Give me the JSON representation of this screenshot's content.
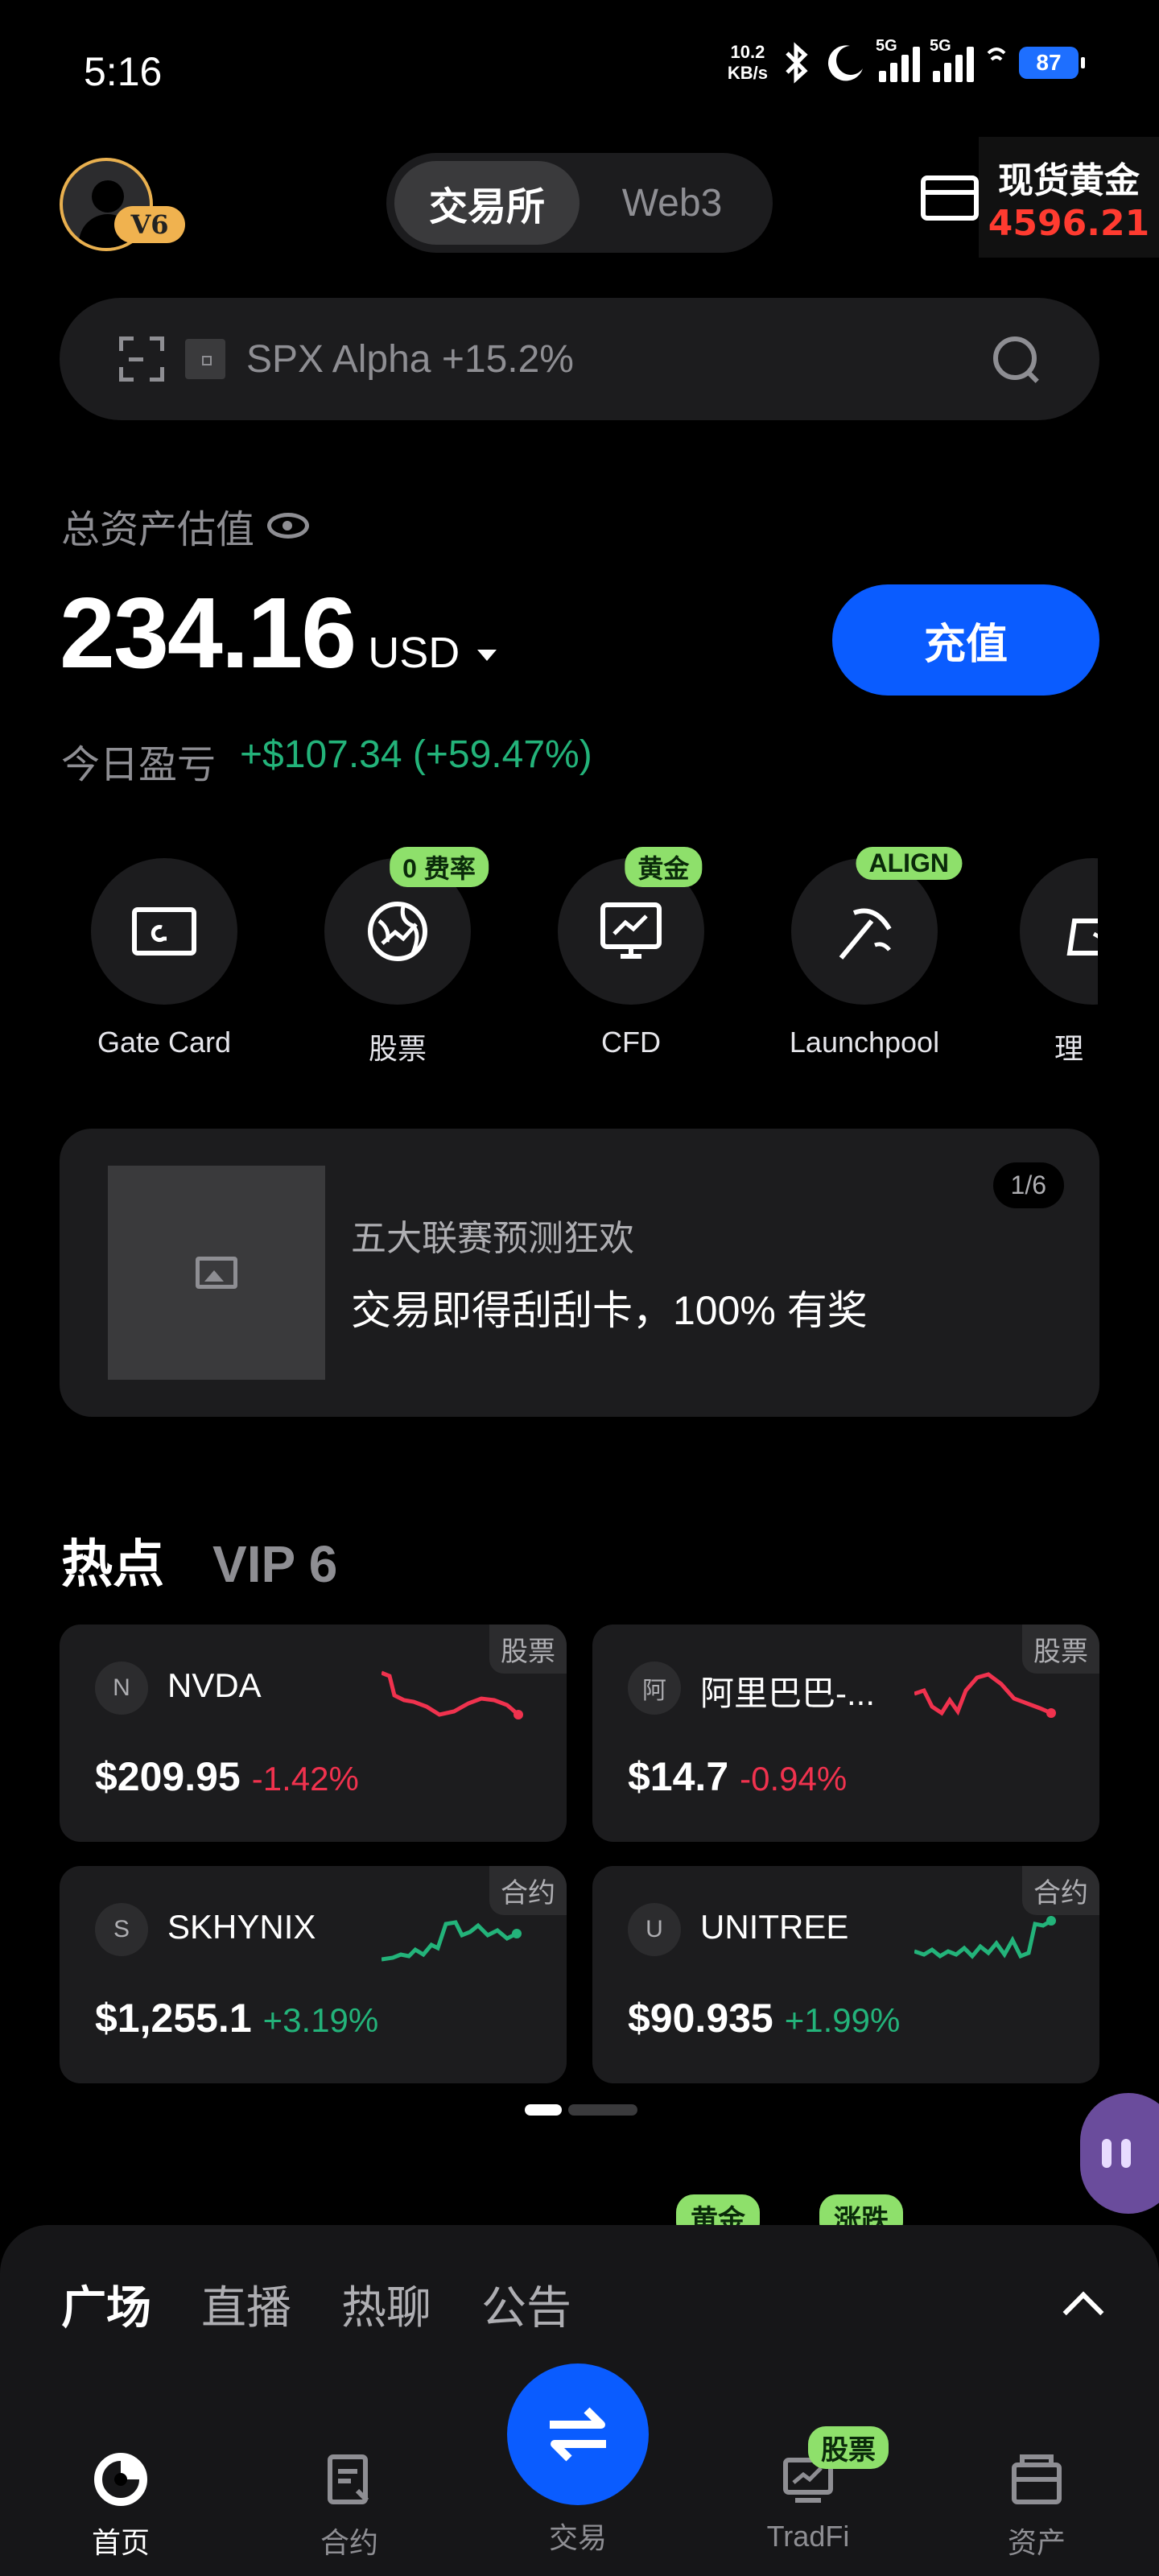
{
  "status_bar": {
    "time": "5:16",
    "net_speed_value": "10.2",
    "net_speed_unit": "KB/s",
    "signal1_label": "5G",
    "signal2_label": "5G",
    "battery": "87"
  },
  "header": {
    "vip_badge": "V6",
    "tabs": [
      {
        "label": "交易所",
        "active": true
      },
      {
        "label": "Web3",
        "active": false
      }
    ],
    "gold_widget_title": "现货黄金",
    "gold_widget_value": "4596.21"
  },
  "search": {
    "placeholder": "SPX Alpha +15.2%"
  },
  "assets": {
    "label": "总资产估值",
    "value": "234.16",
    "currency": "USD",
    "deposit_label": "充值",
    "pnl_label": "今日盈亏",
    "pnl_value": "+$107.34 (+59.47%)"
  },
  "quick_actions": [
    {
      "label": "Gate Card",
      "tag": "",
      "icon": "gate-card-icon"
    },
    {
      "label": "股票",
      "tag": "0 费率",
      "icon": "globe-icon"
    },
    {
      "label": "CFD",
      "tag": "黄金",
      "icon": "chart-monitor-icon"
    },
    {
      "label": "Launchpool",
      "tag": "ALIGN",
      "icon": "pickaxe-icon"
    },
    {
      "label": "理",
      "tag": "",
      "icon": "finance-icon"
    }
  ],
  "banner": {
    "subtitle": "五大联赛预测狂欢",
    "title": "交易即得刮刮卡，100% 有奖",
    "pager": "1/6"
  },
  "hot": {
    "title": "热点",
    "vip_tab": "VIP 6",
    "tiles": [
      {
        "initial": "N",
        "symbol": "NVDA",
        "price": "$209.95",
        "change": "-1.42%",
        "tag": "股票",
        "trend": "down"
      },
      {
        "initial": "阿",
        "symbol": "阿里巴巴-...",
        "price": "$14.7",
        "change": "-0.94%",
        "tag": "股票",
        "trend": "down"
      },
      {
        "initial": "S",
        "symbol": "SKHYNIX",
        "price": "$1,255.1",
        "change": "+3.19%",
        "tag": "合约",
        "trend": "up"
      },
      {
        "initial": "U",
        "symbol": "UNITREE",
        "price": "$90.935",
        "change": "+1.99%",
        "tag": "合约",
        "trend": "up"
      }
    ]
  },
  "peek_tags": [
    "黄金",
    "涨跌"
  ],
  "feed_tabs": [
    "广场",
    "直播",
    "热聊",
    "公告"
  ],
  "bottom_nav": [
    {
      "label": "首页",
      "icon": "home-icon",
      "active": true
    },
    {
      "label": "合约",
      "icon": "contract-icon",
      "active": false
    },
    {
      "label": "交易",
      "icon": "swap-icon",
      "active": false
    },
    {
      "label": "TradFi",
      "icon": "tradfi-icon",
      "active": false,
      "badge": "股票"
    },
    {
      "label": "资产",
      "icon": "wallet-icon",
      "active": false
    }
  ],
  "colors": {
    "accent_blue": "#0a5cff",
    "up_green": "#23b37a",
    "down_red": "#f0324e",
    "tag_green": "#8ee06b"
  }
}
